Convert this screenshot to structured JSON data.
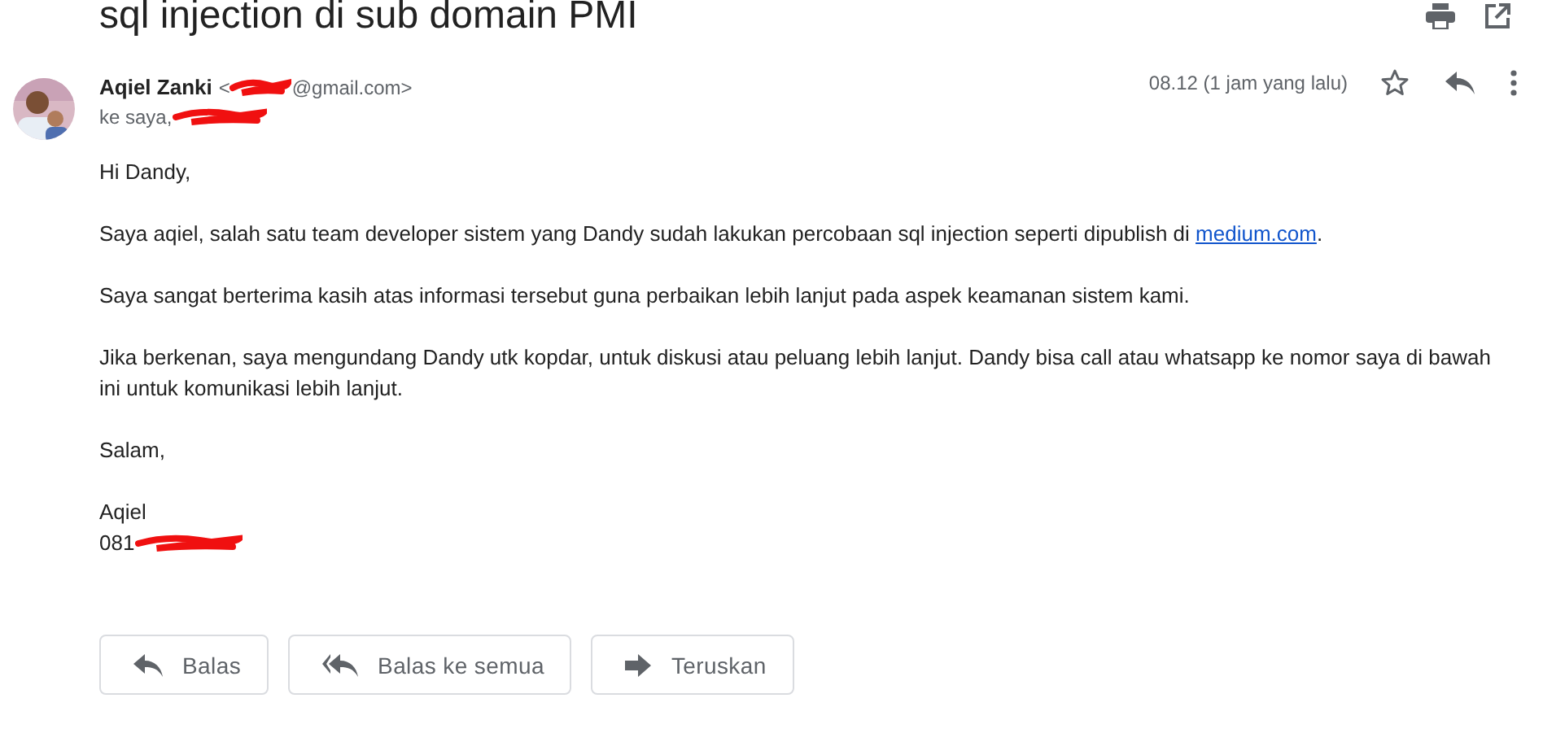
{
  "subject": "sql injection di sub domain PMI",
  "sender": {
    "name": "Aqiel Zanki",
    "email_prefix": "<",
    "email_suffix": "@gmail.com>",
    "recipient": "ke saya,",
    "time": "08.12 (1 jam yang lalu)",
    "starred": false
  },
  "body": [
    {
      "parts": [
        {
          "kind": "text",
          "text": "Hi Dandy,"
        }
      ]
    },
    {
      "parts": [
        {
          "kind": "text",
          "text": "Saya aqiel, salah satu team developer sistem yang Dandy sudah lakukan percobaan sql injection seperti dipublish di "
        },
        {
          "kind": "link",
          "text": "medium.com"
        },
        {
          "kind": "text",
          "text": "."
        }
      ]
    },
    {
      "parts": [
        {
          "kind": "text",
          "text": "Saya sangat berterima kasih atas informasi tersebut guna perbaikan lebih lanjut pada aspek keamanan sistem kami."
        }
      ]
    },
    {
      "parts": [
        {
          "kind": "text",
          "text": "Jika berkenan, saya mengundang Dandy utk kopdar, untuk diskusi atau peluang lebih lanjut. Dandy bisa call atau whatsapp ke nomor saya di bawah ini untuk komunikasi lebih lanjut."
        }
      ]
    },
    {
      "parts": [
        {
          "kind": "text",
          "text": "Salam,"
        }
      ]
    }
  ],
  "signature": {
    "name": "Aqiel",
    "phone": "081"
  },
  "actions": [
    {
      "kind": "reply",
      "label": "Balas"
    },
    {
      "kind": "reply_all",
      "label": "Balas ke semua"
    },
    {
      "kind": "forward",
      "label": "Teruskan"
    }
  ]
}
